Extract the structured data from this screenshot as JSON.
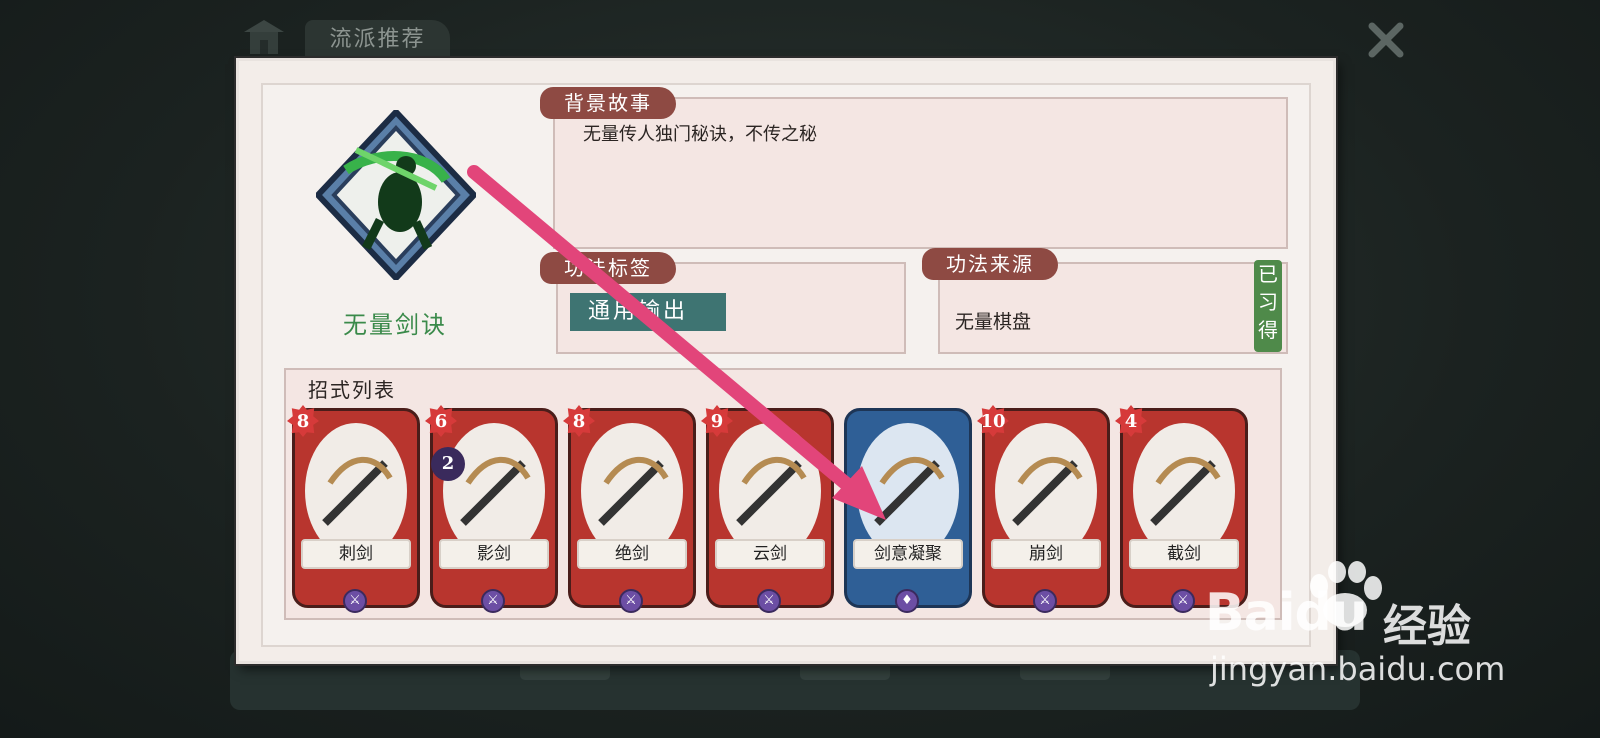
{
  "header": {
    "tab_title": "流派推荐"
  },
  "style": {
    "name": "无量剑诀"
  },
  "background_story": {
    "label": "背景故事",
    "text": "无量传人独门秘诀，不传之秘"
  },
  "technique_tags": {
    "label": "功法标签",
    "tags": [
      "通用输出"
    ]
  },
  "technique_source": {
    "label": "功法来源",
    "text": "无量棋盘",
    "status": "已习得"
  },
  "moves": {
    "title": "招式列表",
    "cards": [
      {
        "name": "刺剑",
        "cost": "8",
        "color": "red",
        "extra": "",
        "type_icon": "sword-icon"
      },
      {
        "name": "影剑",
        "cost": "6",
        "color": "red",
        "extra": "2",
        "type_icon": "sword-icon"
      },
      {
        "name": "绝剑",
        "cost": "8",
        "color": "red",
        "extra": "",
        "type_icon": "sword-icon"
      },
      {
        "name": "云剑",
        "cost": "9",
        "color": "red",
        "extra": "",
        "type_icon": "sword-icon"
      },
      {
        "name": "剑意凝聚",
        "cost": "",
        "color": "blue",
        "extra": "",
        "type_icon": "buff-icon"
      },
      {
        "name": "崩剑",
        "cost": "10",
        "color": "red",
        "extra": "",
        "type_icon": "sword-icon"
      },
      {
        "name": "截剑",
        "cost": "4",
        "color": "red",
        "extra": "",
        "type_icon": "sword-icon"
      }
    ]
  },
  "watermark": {
    "logo": "Baidu",
    "cn": "经验",
    "url": "jingyan.baidu.com"
  },
  "colors": {
    "accent_red": "#b8352e",
    "accent_blue": "#2f5f96",
    "label_brown": "#8e4a43",
    "arrow_pink": "#e2457a"
  }
}
